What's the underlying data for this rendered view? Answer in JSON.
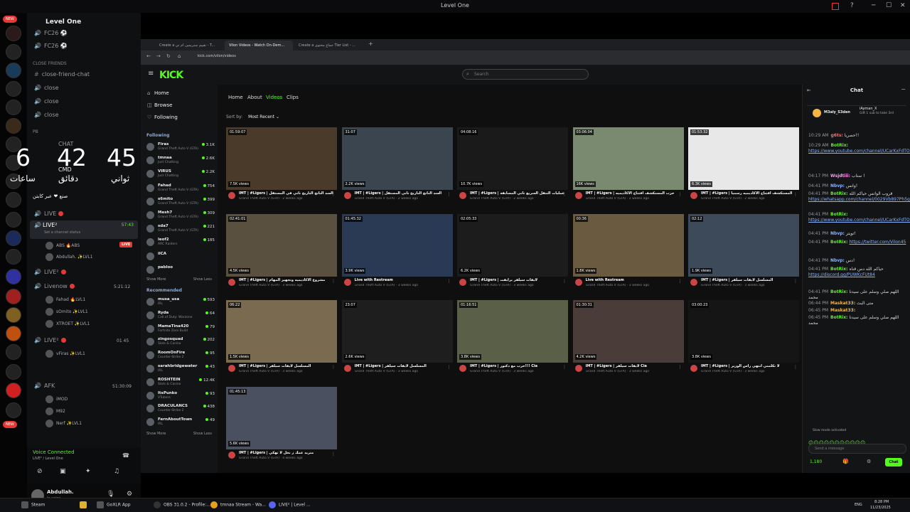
{
  "window": {
    "title": "Level One",
    "ctrl_min": "─",
    "ctrl_max": "☐",
    "ctrl_close": "✕"
  },
  "rail": {
    "new_badge": "NEW",
    "badges": [
      "737",
      "1K+",
      "884",
      "1K+",
      "3K+"
    ]
  },
  "discord": {
    "server_name": "Level One",
    "channels_top": [
      "FC26 ⚽",
      "FC26 ⚽"
    ],
    "category_close": "Close Friends",
    "close_channels": [
      "close-friend-chat",
      "close",
      "close",
      "close"
    ],
    "category_pb": "PB",
    "clock": {
      "h": "6",
      "m": "42",
      "s": "45",
      "lh": "ساعات",
      "lm": "دقائق",
      "ls": "ثواني"
    },
    "pb_channels": [
      "CHAT",
      "CMD"
    ],
    "arabic_line": "صنع ❤ عبر كابتن",
    "live_label": "LIVE",
    "live_active": "LIVE²",
    "live_timer": "57:43",
    "live_status": "Set a channel status",
    "live_users": [
      "ABS 🔥ABS",
      "Abdullah. ✨LVL1"
    ],
    "live_badge": "LIVE",
    "live2": "LIVE²",
    "livenow": "Livenow",
    "livenow_timer": "5:21:12",
    "livenow_users": [
      "Fahad 🔥LVL1",
      "sOmito ✨LVL1",
      "XTROET ✨LVL1"
    ],
    "live3": "LIVE²",
    "live3_timer": "01  45",
    "live3_users": [
      "vFiras ✨LVL1"
    ],
    "afk": "AFK",
    "afk_timer": "51:30:09",
    "afk_users": [
      "iMOD",
      "M92",
      "Nerf ✨LVL1"
    ],
    "voice_connected": "Voice Connected",
    "voice_sub": "LIVE² / Level One",
    "username": "Abdullah.",
    "user_status": "In voice"
  },
  "browser": {
    "tabs": [
      "Create a نقييم ستريمين ام تي - T...",
      "Vilon Videos - Watch On-Dem...",
      "Create a جماع محتوى Tier List - ..."
    ],
    "url": "kick.com/vilon/videos"
  },
  "kick": {
    "logo": "KICK",
    "search_placeholder": "Search",
    "nav": [
      "Home",
      "Browse",
      "Following"
    ],
    "following_title": "Following",
    "following": [
      {
        "name": "Firas",
        "game": "Grand Theft Auto V (GTA)",
        "count": "3.1K"
      },
      {
        "name": "tmnaa",
        "game": "Just Chatting",
        "count": "2.6K"
      },
      {
        "name": "VIRUS",
        "game": "Just Chatting",
        "count": "2.2K"
      },
      {
        "name": "Fahad",
        "game": "Grand Theft Auto V (GTA)",
        "count": "754"
      },
      {
        "name": "s6mito",
        "game": "Grand Theft Auto V (GTA)",
        "count": "399"
      },
      {
        "name": "Mesh7",
        "game": "Grand Theft Auto V (GTA)",
        "count": "309"
      },
      {
        "name": "sda7",
        "game": "Grand Theft Auto V (GTA)",
        "count": "221"
      },
      {
        "name": "leof2",
        "game": "ARC Raiders",
        "count": "185"
      },
      {
        "name": "ilCA",
        "game": "",
        "count": ""
      },
      {
        "name": "pabloo",
        "game": "",
        "count": ""
      }
    ],
    "show_more": "Show More",
    "show_less": "Show Less",
    "recommended_title": "Recommended",
    "recommended": [
      {
        "name": "musa_usa",
        "game": "IRL",
        "count": "593"
      },
      {
        "name": "Ryda",
        "game": "Call of Duty: Warzone",
        "count": "64"
      },
      {
        "name": "MamaTina420",
        "game": "Fortnite Zero Build",
        "count": "79"
      },
      {
        "name": "zingosquad",
        "game": "Slots & Casino",
        "count": "202"
      },
      {
        "name": "RoomOnFire",
        "game": "Counter-Strike 2",
        "count": "95"
      },
      {
        "name": "sarahbridgewater",
        "game": "IRL",
        "count": "43"
      },
      {
        "name": "ROSHTEIN",
        "game": "Slots & Casino",
        "count": "12.4K"
      },
      {
        "name": "ItsPunko",
        "game": "VTubers",
        "count": "93"
      },
      {
        "name": "DRACULANCS",
        "game": "Counter-Strike 2",
        "count": "438"
      },
      {
        "name": "FernAboutTown",
        "game": "IRL",
        "count": "49"
      }
    ],
    "profile_tabs": [
      "Home",
      "About",
      "Videos",
      "Clips"
    ],
    "sort_label": "Sort by:",
    "sort_value": "Most Recent",
    "videos": [
      {
        "dur": "01:59:07",
        "views": "7.5K views",
        "title": "IMT | #Ligers | السد الناتج التاريخ تاني في المستقل",
        "sub": "Grand Theft Auto V (GTA) · 2 weeks ago"
      },
      {
        "dur": "31:07",
        "views": "2.2K views",
        "title": "IMT | #Ligers | السد الناتج التاريخ تاني المستقل",
        "sub": "Grand Theft Auto V (GTA) · 2 weeks ago"
      },
      {
        "dur": "04:08:16",
        "views": "10.7K views",
        "title": "IMT | #Ligers | عمليات التنقل السريع تاني المسابقة",
        "sub": "Grand Theft Auto V (GTA) · 2 weeks ago"
      },
      {
        "dur": "03:06:04",
        "views": "16K views",
        "title": "IMT | #Ligers | حزب المستكشف افتتاح الاكاديميه",
        "sub": "Grand Theft Auto V (GTA) · 2 weeks ago"
      },
      {
        "dur": "01:53:32",
        "views": "6.3K views",
        "title": "IMT | #Ligers | المستكشف افتتاح الاكاديميه رسمياً",
        "sub": "Grand Theft Auto V (GTA) · 2 weeks ago"
      },
      {
        "dur": "02:41:01",
        "views": "4.5K views",
        "title": "IMT | #Ligers | مشروع الاكاديميه وتجهيز المهام",
        "sub": "Grand Theft Auto V (GTA) · 3 weeks ago"
      },
      {
        "dur": "01:45:32",
        "views": "3.9K views",
        "title": "Live with Restream",
        "sub": "Grand Theft Auto V (GTA) · 3 weeks ago"
      },
      {
        "dur": "02:05:33",
        "views": "6.2K views",
        "title": "IMT | #Ligers | لايفات سيلفر برايفت",
        "sub": "Grand Theft Auto V (GTA) · 3 weeks ago"
      },
      {
        "dur": "00:36",
        "views": "1.8K views",
        "title": "Live with Restream",
        "sub": "Grand Theft Auto V (GTA) · 3 weeks ago"
      },
      {
        "dur": "02:12",
        "views": "1.9K views",
        "title": "IMT | #Ligers | المسلسل لايفات سيلفر",
        "sub": "Grand Theft Auto V (GTA) · 3 weeks ago"
      },
      {
        "dur": "06:22",
        "views": "1.5K views",
        "title": "IMT | #Ligers | المسلسل لايفات سيلفر",
        "sub": "Grand Theft Auto V (GTA) · 3 weeks ago"
      },
      {
        "dur": "23:07",
        "views": "2.6K views",
        "title": "IMT | #Ligers | المسلسل لايفات سيلفر",
        "sub": "Grand Theft Auto V (GTA) · 3 weeks ago"
      },
      {
        "dur": "01:16:51",
        "views": "3.8K views",
        "title": "IMT | #Ligers | حرب مع دكتور!!! Cia",
        "sub": "Grand Theft Auto V (GTA) · 3 weeks ago"
      },
      {
        "dur": "01:30:31",
        "views": "4.2K views",
        "title": "IMT | #Ligers | لايفات سيلفر Cia",
        "sub": "Grand Theft Auto V (GTA) · 3 weeks ago"
      },
      {
        "dur": "03:00:23",
        "views": "3.8K views",
        "title": "IMT | #Ligers | لا تكلمني انتهي راس الوزير",
        "sub": "Grand Theft Auto V (GTA) · 3 weeks ago"
      },
      {
        "dur": "01:45:13",
        "views": "5.6K views",
        "title": "IMT | #Ligers | متريد عمك ز نخل لا تهكي",
        "sub": "Grand Theft Auto V (GTA) · 4 weeks ago"
      }
    ],
    "chat": {
      "title": "Chat",
      "pinned_user": "M3aly_S3den",
      "pinned_user2": "iAyman_X",
      "pinned_gift": "Gift 1 sub to take 3rd",
      "messages": [
        {
          "t": "10:29 AM",
          "u": "g6ts:",
          "m": "حصريا!!",
          "link": "",
          "uc": "#ff6b6b"
        },
        {
          "t": "10:29 AM",
          "u": "BotRix:",
          "m": "",
          "link": "https://www.youtube.com/channel/UCarKxFdTOwury7d9OCj5kZQ",
          "uc": "#53fc18"
        },
        {
          "t": "04:17 PM",
          "u": "Wsjdtiii:",
          "m": "ستاب !",
          "link": "",
          "uc": "#ff9bf0"
        },
        {
          "t": "04:41 PM",
          "u": "Nbvp:",
          "m": "وانس!",
          "link": "",
          "uc": "#8ab4ff"
        },
        {
          "t": "04:41 PM",
          "u": "BotRix:",
          "m": "قروب الواتس حياكم الله",
          "link": "https://whatsapp.com/channel/0029Vb897Ph5g08cUUdbfX2c",
          "uc": "#53fc18"
        },
        {
          "t": "04:41 PM",
          "u": "BotRix:",
          "m": "",
          "link": "https://www.youtube.com/channel/UCarKxFdTOwury7d9OCj5kZQ",
          "uc": "#53fc18"
        },
        {
          "t": "04:41 PM",
          "u": "Nbvp:",
          "m": "تويتر!",
          "link": "",
          "uc": "#8ab4ff"
        },
        {
          "t": "04:41 PM",
          "u": "BotRix:",
          "m": "",
          "link": "https://twitter.com/Vilon45",
          "uc": "#53fc18"
        },
        {
          "t": "04:41 PM",
          "u": "Nbvp:",
          "m": "دس!",
          "link": "",
          "uc": "#8ab4ff"
        },
        {
          "t": "04:41 PM",
          "u": "BotRix:",
          "m": "حياكم الله دس قناه",
          "link": "https://discord.gg/PUWKcFUt84",
          "uc": "#53fc18"
        },
        {
          "t": "04:41 PM",
          "u": "BotRix:",
          "m": "اللهم صلي وسلم على سيدنا محمد",
          "link": "",
          "uc": "#53fc18"
        },
        {
          "t": "06:44 PM",
          "u": "Maskat33:",
          "m": "متى البث",
          "link": "",
          "uc": "#f5b642"
        },
        {
          "t": "06:45 PM",
          "u": "Maskat33:",
          "m": "",
          "link": "",
          "uc": "#f5b642"
        },
        {
          "t": "06:45 PM",
          "u": "BotRix:",
          "m": "اللهم صلي وسلم على سيدنا محمد",
          "link": "",
          "uc": "#53fc18"
        }
      ],
      "slow_mode": "Slow mode activated",
      "input_placeholder": "Send a message",
      "points": "1,180",
      "send": "Chat"
    }
  },
  "taskbar": {
    "apps": [
      "Steam",
      "",
      "GoXLR App",
      "OBS 31.0.2 - Profile:...",
      "tmnaa Stream - Wa...",
      "LIVE² | Level ..."
    ],
    "lang": "ENG",
    "time": "8:28 PM",
    "date": "11/23/2025"
  }
}
